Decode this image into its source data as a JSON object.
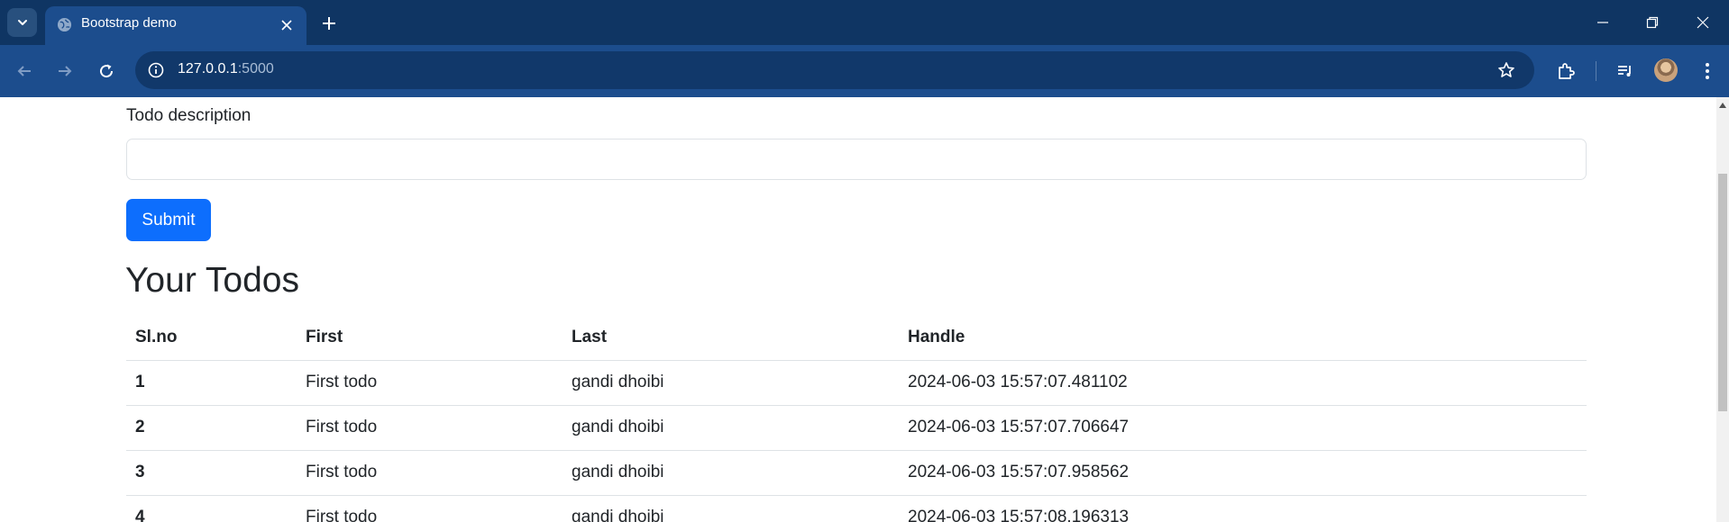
{
  "browser": {
    "tab": {
      "title": "Bootstrap demo",
      "favicon": "globe-icon"
    },
    "url": {
      "host": "127.0.0.1",
      "port": ":5000"
    },
    "colors": {
      "tabstrip": "#0f3563",
      "toolbar": "#1c4d8d",
      "omnibox": "#11386a"
    }
  },
  "form": {
    "description_label": "Todo description",
    "description_value": "",
    "submit_label": "Submit"
  },
  "todos": {
    "heading": "Your Todos",
    "columns": [
      "Sl.no",
      "First",
      "Last",
      "Handle"
    ],
    "rows": [
      [
        "1",
        "First todo",
        "gandi dhoibi",
        "2024-06-03 15:57:07.481102"
      ],
      [
        "2",
        "First todo",
        "gandi dhoibi",
        "2024-06-03 15:57:07.706647"
      ],
      [
        "3",
        "First todo",
        "gandi dhoibi",
        "2024-06-03 15:57:07.958562"
      ],
      [
        "4",
        "First todo",
        "gandi dhoibi",
        "2024-06-03 15:57:08.196313"
      ]
    ]
  },
  "colors": {
    "primary": "#0d6efd",
    "text": "#212529",
    "border": "#dee2e6"
  }
}
